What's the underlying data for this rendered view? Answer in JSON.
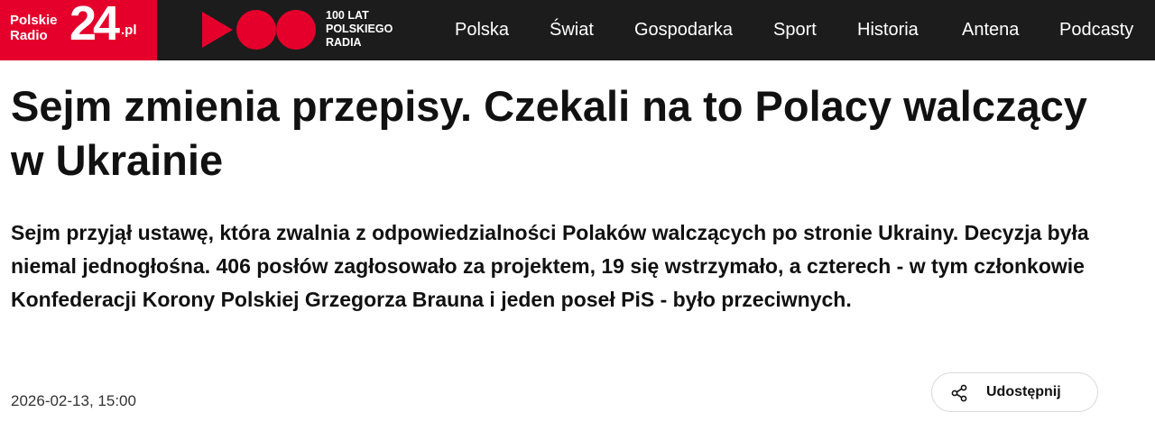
{
  "header": {
    "logo": {
      "line1": "Polskie",
      "line2": "Radio",
      "number": "24",
      "suffix": ".pl"
    },
    "anniversary": {
      "line1": "100 LAT",
      "line2": "POLSKIEGO",
      "line3": "RADIA"
    },
    "nav": [
      {
        "label": "Polska"
      },
      {
        "label": "Świat"
      },
      {
        "label": "Gospodarka"
      },
      {
        "label": "Sport"
      },
      {
        "label": "Historia"
      },
      {
        "label": "Antena"
      },
      {
        "label": "Podcasty"
      }
    ]
  },
  "article": {
    "title": "Sejm zmienia przepisy. Czekali na to Polacy walczący w Ukrainie",
    "lead": "Sejm przyjął ustawę, która zwalnia z odpowiedzialności Polaków walczących po stronie Ukrainy. Decyzja była niemal jednogłośna. 406 posłów zagłosowało za projektem, 19 się wstrzymało, a czterech - w tym członkowie Konfederacji Korony Polskiej Grzegorza Brauna i jeden poseł PiS - było przeciwnych.",
    "date": "2026-02-13, 15:00",
    "share_label": "Udostępnij",
    "share_icon": "share-icon"
  },
  "colors": {
    "brand_red": "#e4002b",
    "topbar": "#1c1c1c"
  }
}
